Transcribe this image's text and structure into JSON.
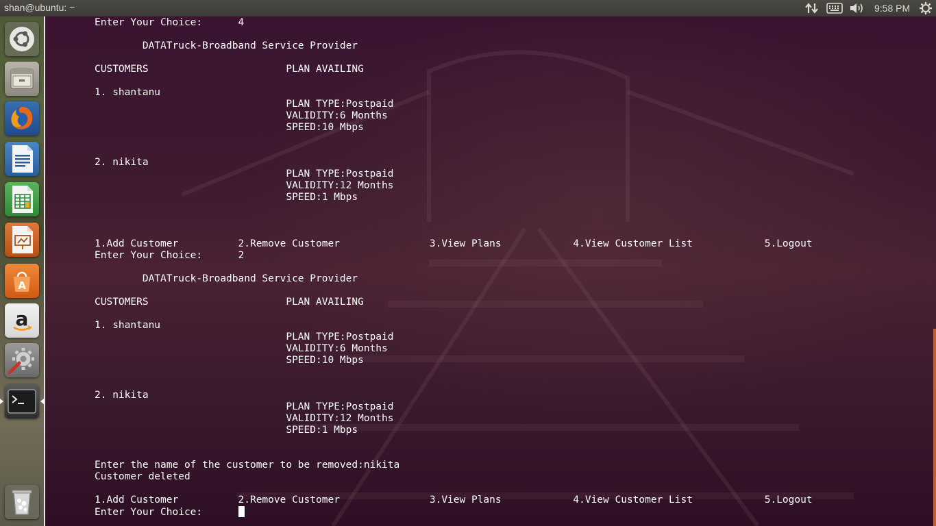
{
  "window": {
    "title": "shan@ubuntu: ~"
  },
  "panel": {
    "clock": "9:58 PM"
  },
  "launcher": {
    "items": [
      {
        "name": "ubuntu-dash-icon"
      },
      {
        "name": "files-icon"
      },
      {
        "name": "firefox-icon"
      },
      {
        "name": "libreoffice-writer-icon"
      },
      {
        "name": "libreoffice-calc-icon"
      },
      {
        "name": "libreoffice-impress-icon"
      },
      {
        "name": "ubuntu-software-icon"
      },
      {
        "name": "amazon-icon"
      },
      {
        "name": "system-settings-icon"
      },
      {
        "name": "terminal-icon"
      },
      {
        "name": "trash-icon"
      }
    ]
  },
  "terminal": {
    "lines": [
      "Enter Your Choice:      4",
      "",
      "        DATATruck-Broadband Service Provider",
      "",
      "CUSTOMERS                       PLAN AVAILING",
      "",
      "1. shantanu",
      "                                PLAN TYPE:Postpaid",
      "                                VALIDITY:6 Months",
      "                                SPEED:10 Mbps",
      "",
      "",
      "2. nikita",
      "                                PLAN TYPE:Postpaid",
      "                                VALIDITY:12 Months",
      "                                SPEED:1 Mbps",
      "",
      "",
      "",
      "1.Add Customer          2.Remove Customer               3.View Plans            4.View Customer List            5.Logout",
      "Enter Your Choice:      2",
      "",
      "        DATATruck-Broadband Service Provider",
      "",
      "CUSTOMERS                       PLAN AVAILING",
      "",
      "1. shantanu",
      "                                PLAN TYPE:Postpaid",
      "                                VALIDITY:6 Months",
      "                                SPEED:10 Mbps",
      "",
      "",
      "2. nikita",
      "                                PLAN TYPE:Postpaid",
      "                                VALIDITY:12 Months",
      "                                SPEED:1 Mbps",
      "",
      "",
      "Enter the name of the customer to be removed:nikita",
      "Customer deleted",
      "",
      "1.Add Customer          2.Remove Customer               3.View Plans            4.View Customer List            5.Logout"
    ],
    "prompt": "Enter Your Choice:      "
  },
  "colors": {
    "terminal_bg": "#3a1430",
    "terminal_fg": "#ffffff",
    "panel_bg": "#3c3b37",
    "scrollbar": "#c06030"
  }
}
